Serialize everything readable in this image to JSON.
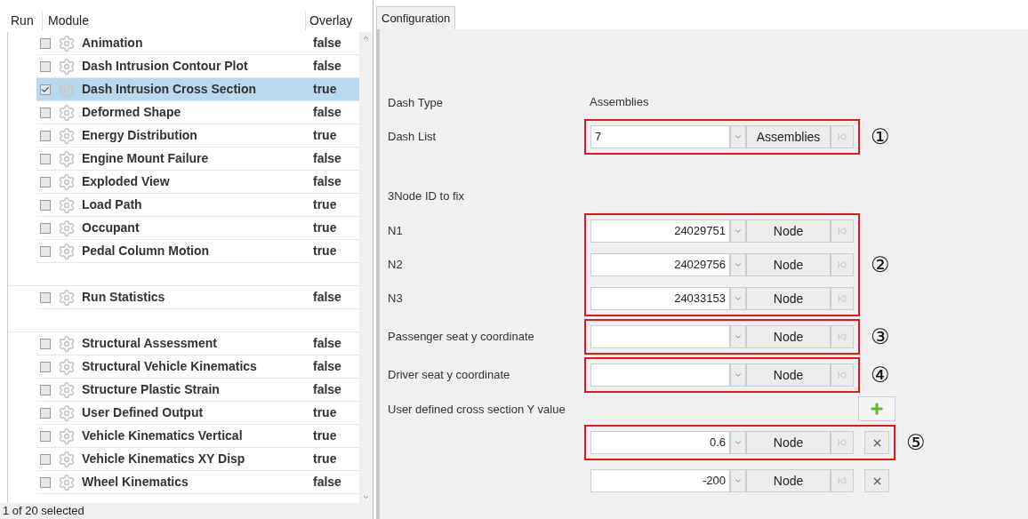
{
  "module_table": {
    "columns": [
      "Run",
      "Module",
      "Overlay"
    ],
    "rows": [
      {
        "kind": "module",
        "checked": false,
        "selected": false,
        "name": "Animation",
        "overlay": "false"
      },
      {
        "kind": "module",
        "checked": false,
        "selected": false,
        "name": "Dash Intrusion Contour Plot",
        "overlay": "false"
      },
      {
        "kind": "module",
        "checked": true,
        "selected": true,
        "name": "Dash Intrusion Cross Section",
        "overlay": "true"
      },
      {
        "kind": "module",
        "checked": false,
        "selected": false,
        "name": "Deformed Shape",
        "overlay": "false"
      },
      {
        "kind": "module",
        "checked": false,
        "selected": false,
        "name": "Energy Distribution",
        "overlay": "true"
      },
      {
        "kind": "module",
        "checked": false,
        "selected": false,
        "name": "Engine Mount Failure",
        "overlay": "false"
      },
      {
        "kind": "module",
        "checked": false,
        "selected": false,
        "name": "Exploded View",
        "overlay": "false"
      },
      {
        "kind": "module",
        "checked": false,
        "selected": false,
        "name": "Load Path",
        "overlay": "true"
      },
      {
        "kind": "module",
        "checked": false,
        "selected": false,
        "name": "Occupant",
        "overlay": "true"
      },
      {
        "kind": "module",
        "checked": false,
        "selected": false,
        "name": "Pedal Column Motion",
        "overlay": "true"
      },
      {
        "kind": "blank"
      },
      {
        "kind": "module",
        "checked": false,
        "selected": false,
        "name": "Run Statistics",
        "overlay": "false"
      },
      {
        "kind": "blank"
      },
      {
        "kind": "module",
        "checked": false,
        "selected": false,
        "name": "Structural Assessment",
        "overlay": "false"
      },
      {
        "kind": "module",
        "checked": false,
        "selected": false,
        "name": "Structural Vehicle Kinematics",
        "overlay": "false"
      },
      {
        "kind": "module",
        "checked": false,
        "selected": false,
        "name": "Structure Plastic Strain",
        "overlay": "false"
      },
      {
        "kind": "module",
        "checked": false,
        "selected": false,
        "name": "User Defined Output",
        "overlay": "true"
      },
      {
        "kind": "module",
        "checked": false,
        "selected": false,
        "name": "Vehicle Kinematics Vertical",
        "overlay": "true"
      },
      {
        "kind": "module",
        "checked": false,
        "selected": false,
        "name": "Vehicle Kinematics XY Disp",
        "overlay": "true"
      },
      {
        "kind": "module",
        "checked": false,
        "selected": false,
        "name": "Wheel Kinematics",
        "overlay": "false"
      }
    ]
  },
  "status_bar": "1 of 20 selected",
  "tabs": [
    {
      "label": "Configuration",
      "selected": true
    }
  ],
  "form": [
    {
      "kind": "text",
      "label": "Dash Type",
      "value": "Assemblies"
    },
    {
      "kind": "group",
      "callout": "①",
      "rows": [
        {
          "kind": "list",
          "label": "Dash List",
          "value": "7",
          "button": "Assemblies",
          "removable": false
        }
      ]
    },
    {
      "kind": "heading",
      "label": "3Node ID to fix"
    },
    {
      "kind": "group",
      "callout": "②",
      "rows": [
        {
          "kind": "node",
          "label": "N1",
          "value": "24029751",
          "button": "Node",
          "removable": false
        },
        {
          "kind": "node",
          "label": "N2",
          "value": "24029756",
          "button": "Node",
          "removable": false
        },
        {
          "kind": "node",
          "label": "N3",
          "value": "24033153",
          "button": "Node",
          "removable": false
        }
      ]
    },
    {
      "kind": "group",
      "callout": "③",
      "rows": [
        {
          "kind": "node",
          "label": "Passenger seat y coordinate",
          "button": "Node",
          "removable": false
        }
      ]
    },
    {
      "kind": "group",
      "callout": "④",
      "rows": [
        {
          "kind": "node",
          "label": "Driver seat y coordinate",
          "button": "Node",
          "removable": false
        }
      ]
    },
    {
      "kind": "add",
      "label": "User defined cross section Y value"
    },
    {
      "kind": "group",
      "callout": "⑤",
      "rows": [
        {
          "kind": "node",
          "value": "0.6",
          "button": "Node",
          "removable": true
        }
      ]
    },
    {
      "kind": "plain",
      "rows": [
        {
          "kind": "node",
          "value": "-200",
          "button": "Node",
          "removable": true
        }
      ]
    }
  ]
}
